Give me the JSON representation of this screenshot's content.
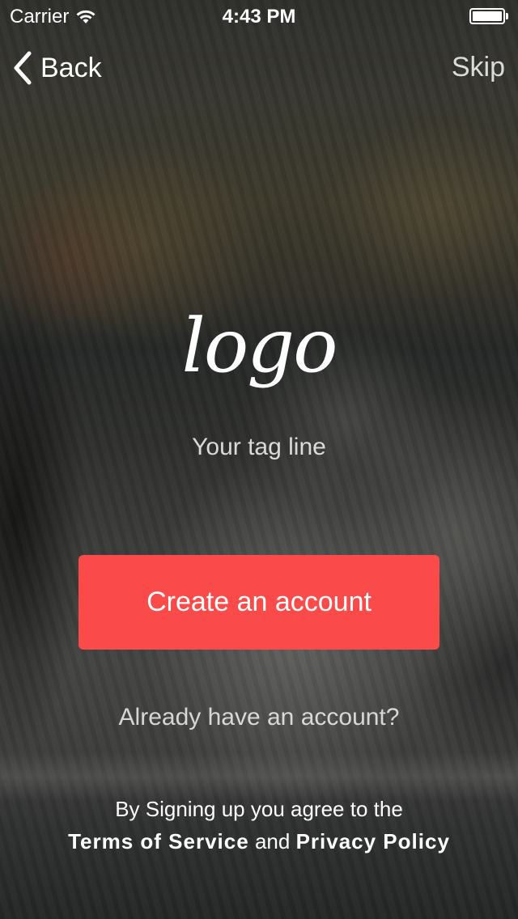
{
  "status_bar": {
    "carrier": "Carrier",
    "time": "4:43 PM",
    "wifi_icon": "wifi-icon",
    "battery_icon": "battery-icon"
  },
  "nav": {
    "back_label": "Back",
    "back_icon": "chevron-left-icon",
    "skip_label": "Skip"
  },
  "hero": {
    "logo_text": "logo",
    "tagline": "Your tag line"
  },
  "actions": {
    "create_account_label": "Create an account",
    "login_link_label": "Already have an account?"
  },
  "legal": {
    "prefix": "By Signing up you agree to the",
    "terms_label": "Terms of Service",
    "conjunction": "and",
    "privacy_label": "Privacy Policy"
  },
  "colors": {
    "primary_button": "#fb4a4a",
    "text": "#ffffff"
  }
}
